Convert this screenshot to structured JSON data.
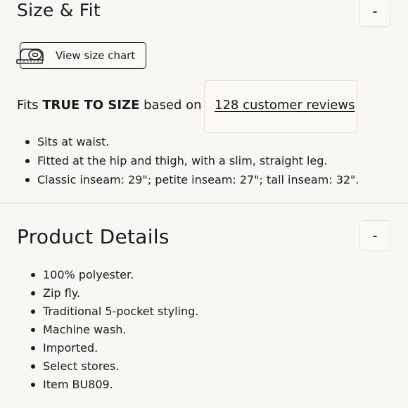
{
  "size_fit": {
    "title": "Size & Fit",
    "toggle_label": "-",
    "size_chart_label": "View size chart",
    "fit_prefix": "Fits ",
    "fit_emphasis": "TRUE TO SIZE",
    "fit_suffix": " based on",
    "reviews_link": "128 customer reviews",
    "bullets": [
      "Sits at waist.",
      "Fitted at the hip and thigh, with a slim, straight leg.",
      "Classic inseam: 29\"; petite inseam: 27\"; tall inseam: 32\"."
    ]
  },
  "product_details": {
    "title": "Product Details",
    "toggle_label": "-",
    "bullets": [
      "100% polyester.",
      "Zip fly.",
      "Traditional 5-pocket styling.",
      "Machine wash.",
      "Imported.",
      "Select stores.",
      "Item BU809."
    ]
  },
  "icons": {
    "size_chart": "measuring-tape-icon"
  }
}
